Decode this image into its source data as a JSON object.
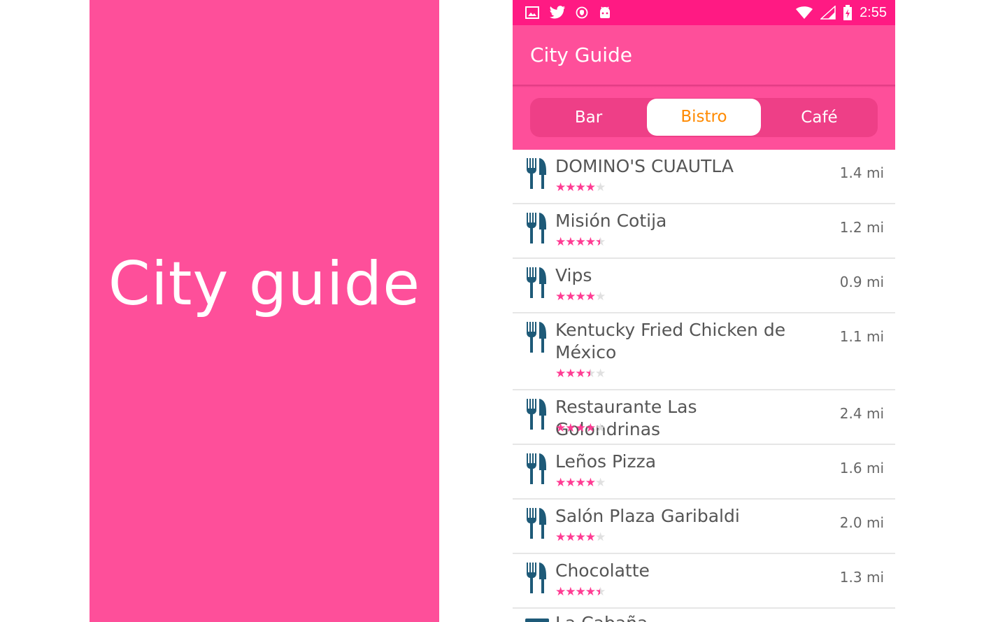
{
  "promo": {
    "title": "City guide"
  },
  "status_bar": {
    "time": "2:55",
    "icons": [
      "image-icon",
      "twitter-icon",
      "shield-icon",
      "android-icon",
      "wifi-icon",
      "signal-icon",
      "battery-charging-icon"
    ]
  },
  "app_bar": {
    "title": "City Guide"
  },
  "tabs": [
    {
      "label": "Bar",
      "active": false
    },
    {
      "label": "Bistro",
      "active": true
    },
    {
      "label": "Café",
      "active": false
    }
  ],
  "places": [
    {
      "name": "DOMINO'S CUAUTLA",
      "rating": 4,
      "distance": "1.4 mi"
    },
    {
      "name": "Misión Cotija",
      "rating": 4.5,
      "distance": "1.2 mi"
    },
    {
      "name": "Vips",
      "rating": 4,
      "distance": "0.9 mi"
    },
    {
      "name": "Kentucky Fried Chicken de México",
      "rating": 3.5,
      "distance": "1.1 mi"
    },
    {
      "name": "Restaurante Las Golondrinas",
      "rating": 4,
      "distance": "2.4 mi"
    },
    {
      "name": "Leños Pizza",
      "rating": 4,
      "distance": "1.6 mi"
    },
    {
      "name": "Salón Plaza Garibaldi",
      "rating": 4,
      "distance": "2.0 mi"
    },
    {
      "name": "Chocolatte",
      "rating": 4.5,
      "distance": "1.3 mi"
    }
  ],
  "partial_item": {
    "name": "La Cabaña"
  },
  "colors": {
    "primary": "#fe4f9a",
    "status_bar": "#ff1a83",
    "accent": "#ff8a00",
    "star": "#ff3c93",
    "icon": "#1e5a78"
  }
}
